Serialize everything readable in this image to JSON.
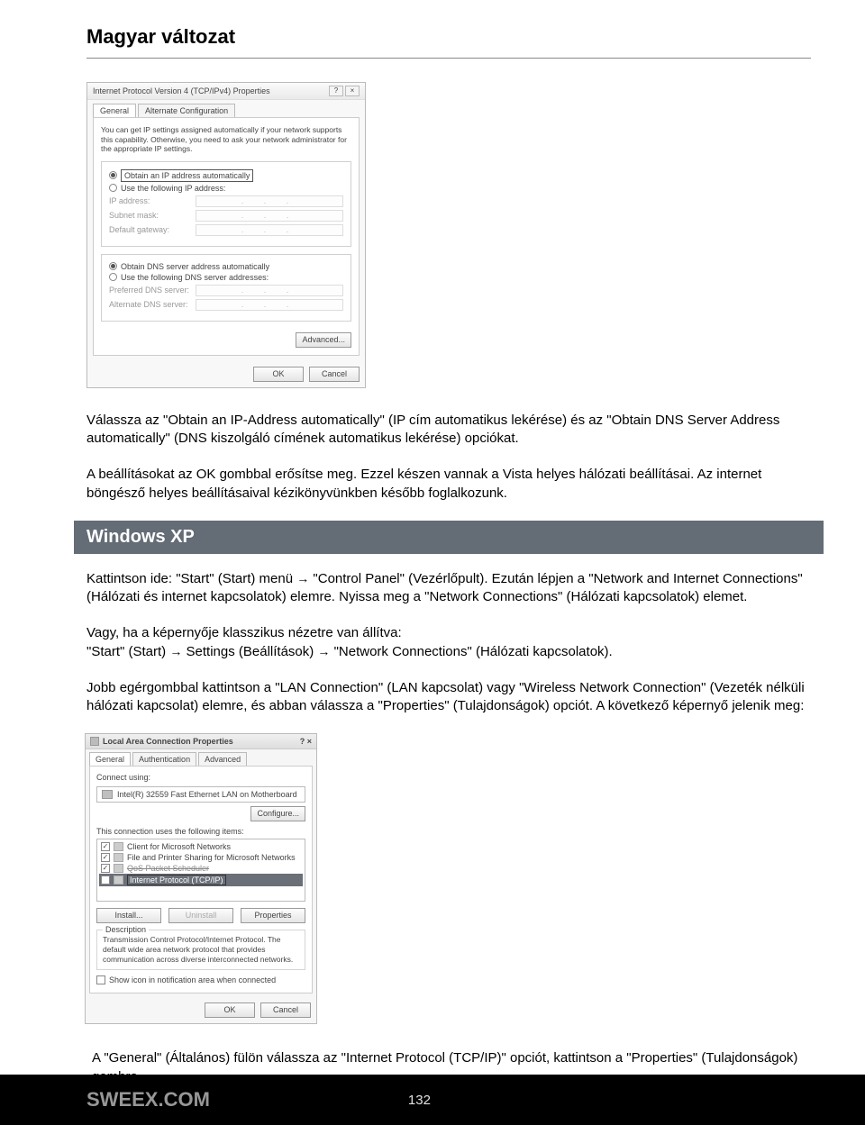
{
  "header": {
    "title": "Magyar változat"
  },
  "dialog1": {
    "title": "Internet Protocol Version 4 (TCP/IPv4) Properties",
    "tabs": {
      "general": "General",
      "alt": "Alternate Configuration"
    },
    "desc": "You can get IP settings assigned automatically if your network supports this capability. Otherwise, you need to ask your network administrator for the appropriate IP settings.",
    "radios": {
      "obtain_ip": "Obtain an IP address automatically",
      "use_ip": "Use the following IP address:",
      "obtain_dns": "Obtain DNS server address automatically",
      "use_dns": "Use the following DNS server addresses:"
    },
    "labels": {
      "ip": "IP address:",
      "subnet": "Subnet mask:",
      "gateway": "Default gateway:",
      "pref_dns": "Preferred DNS server:",
      "alt_dns": "Alternate DNS server:"
    },
    "buttons": {
      "advanced": "Advanced...",
      "ok": "OK",
      "cancel": "Cancel"
    },
    "dots": ".   .   ."
  },
  "paras": {
    "p1": "Válassza az \"Obtain an IP-Address automatically\" (IP cím automatikus lekérése) és az \"Obtain DNS Server Address automatically\" (DNS kiszolgáló címének automatikus lekérése) opciókat.",
    "p2": "A beállításokat az OK gombbal erősítse meg. Ezzel készen vannak a Vista helyes hálózati beállításai. Az internet böngésző helyes beállításaival kézikönyvünkben később foglalkozunk.",
    "xp_title": "Windows XP",
    "p3a": "Kattintson ide: \"Start\" (Start) menü ",
    "p3b": " \"Control Panel\" (Vezérlőpult). Ezután lépjen a \"Network and Internet Connections\" (Hálózati és internet kapcsolatok) elemre. Nyissa meg a \"Network Connections\" (Hálózati kapcsolatok) elemet.",
    "p4a": "Vagy, ha a képernyője klasszikus nézetre van állítva:",
    "p4b": "\"Start\" (Start) ",
    "p4c": " Settings (Beállítások) ",
    "p4d": " \"Network Connections\" (Hálózati kapcsolatok).",
    "p5": "Jobb egérgombbal kattintson a \"LAN Connection\" (LAN kapcsolat) vagy \"Wireless Network Connection\" (Vezeték nélküli hálózati kapcsolat) elemre, és abban válassza a \"Properties\" (Tulajdonságok) opciót. A következő képernyő jelenik meg:",
    "p6": "A \"General\" (Általános) fülön válassza az \"Internet Protocol (TCP/IP)\" opciót, kattintson a \"Properties\" (Tulajdonságok) gombra.",
    "arrow": "→"
  },
  "dialog2": {
    "title": "Local Area Connection Properties",
    "tabs": {
      "general": "General",
      "auth": "Authentication",
      "adv": "Advanced"
    },
    "connect_using": "Connect using:",
    "nic": "Intel(R) 32559 Fast Ethernet LAN on Motherboard",
    "configure": "Configure...",
    "uses": "This connection uses the following items:",
    "items": {
      "i1": "Client for Microsoft Networks",
      "i2": "File and Printer Sharing for Microsoft Networks",
      "i3": "QoS Packet Scheduler",
      "i4": "Internet Protocol (TCP/IP)"
    },
    "buttons": {
      "install": "Install...",
      "uninstall": "Uninstall",
      "properties": "Properties",
      "ok": "OK",
      "cancel": "Cancel"
    },
    "desc_legend": "Description",
    "desc_text": "Transmission Control Protocol/Internet Protocol. The default wide area network protocol that provides communication across diverse interconnected networks.",
    "show_icon": "Show icon in notification area when connected"
  },
  "footer": {
    "brand": "SWEEX.COM",
    "page": "132"
  }
}
